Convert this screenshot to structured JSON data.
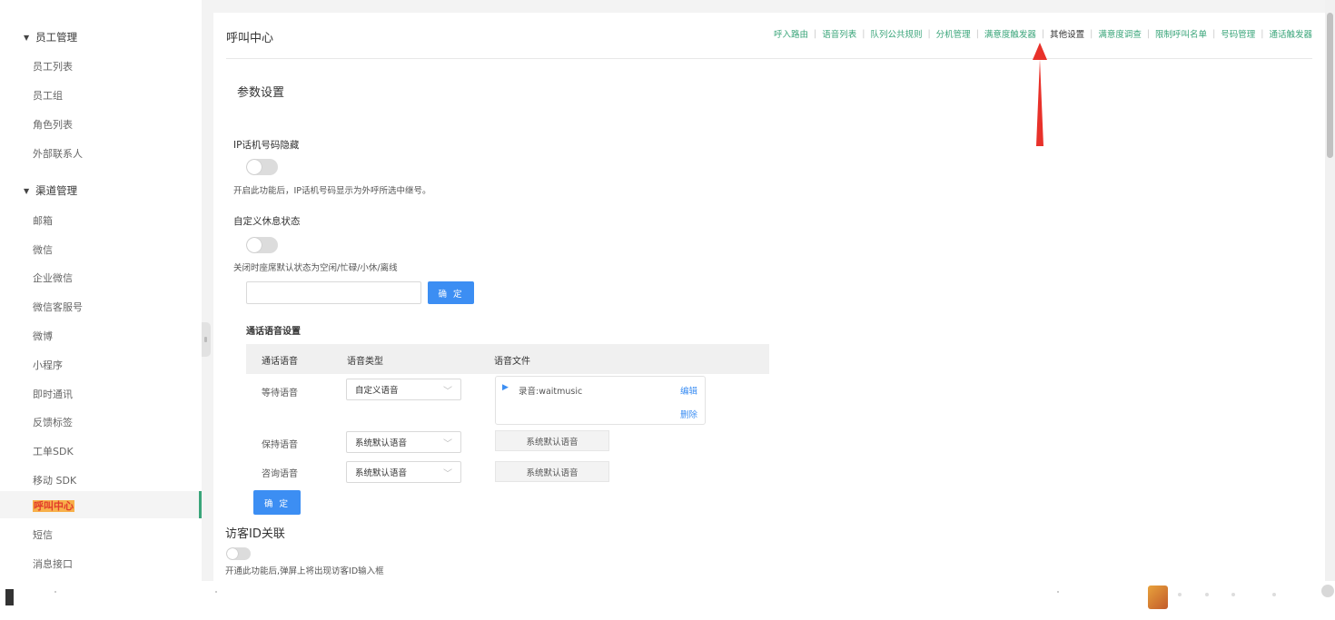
{
  "sidebar": {
    "groups": [
      {
        "label": "员工管理",
        "items": [
          "员工列表",
          "员工组",
          "角色列表",
          "外部联系人"
        ]
      },
      {
        "label": "渠道管理",
        "items": [
          "邮箱",
          "微信",
          "企业微信",
          "微信客服号",
          "微博",
          "小程序",
          "即时通讯",
          "反馈标签",
          "工单SDK",
          "移动 SDK",
          "呼叫中心",
          "短信",
          "消息接口"
        ]
      }
    ],
    "active_item": "呼叫中心"
  },
  "header": {
    "title": "呼叫中心",
    "nav": [
      "呼入路由",
      "语音列表",
      "队列公共规则",
      "分机管理",
      "满意度触发器",
      "其他设置",
      "满意度调查",
      "限制呼叫名单",
      "号码管理",
      "通话触发器"
    ],
    "current_nav": "其他设置"
  },
  "params": {
    "section_title": "参数设置",
    "ip_hide": {
      "label": "IP话机号码隐藏",
      "enabled": false,
      "help": "开启此功能后，IP话机号码显示为外呼所选中继号。"
    },
    "custom_rest": {
      "label": "自定义休息状态",
      "enabled": false,
      "help": "关闭时座席默认状态为空闲/忙碌/小休/离线",
      "input_value": "",
      "confirm_label": "确 定"
    }
  },
  "voice_settings": {
    "title": "通话语音设置",
    "columns": [
      "通话语音",
      "语音类型",
      "语音文件"
    ],
    "rows": [
      {
        "name": "等待语音",
        "type": "自定义语音",
        "file": "录音:waitmusic",
        "edit": "编辑",
        "delete": "删除"
      },
      {
        "name": "保持语音",
        "type": "系统默认语音",
        "file_button": "系统默认语音"
      },
      {
        "name": "咨询语音",
        "type": "系统默认语音",
        "file_button": "系统默认语音"
      }
    ],
    "confirm_label": "确 定"
  },
  "visitor": {
    "title": "访客ID关联",
    "enabled": false,
    "help": "开通此功能后,弹屏上将出现访客ID输入框"
  },
  "colors": {
    "accent_green": "#3aa57a",
    "primary_blue": "#3c8ef3",
    "arrow_red": "#e8312a"
  }
}
